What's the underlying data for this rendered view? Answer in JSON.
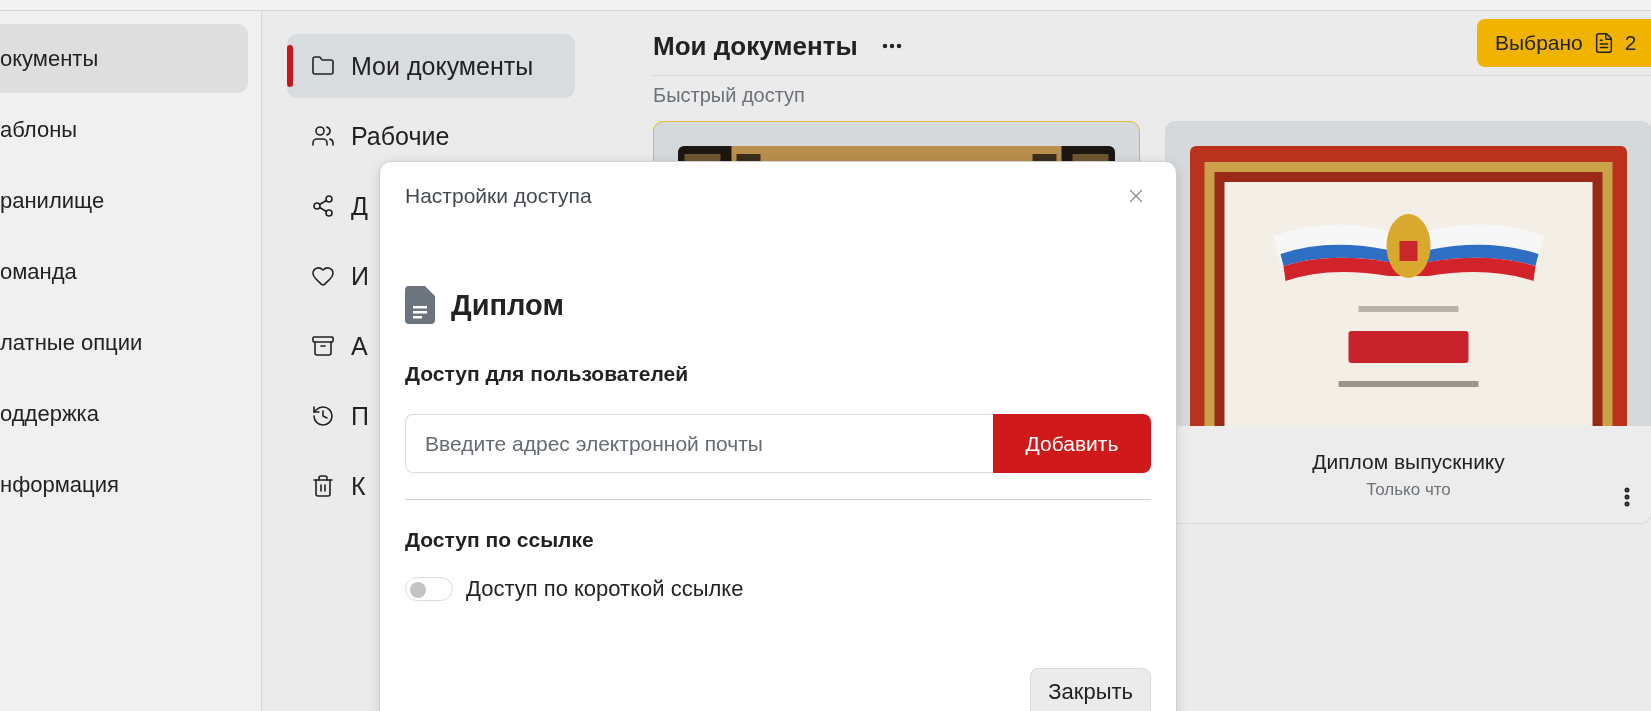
{
  "sidebar": {
    "items": [
      {
        "label": "окументы",
        "selected": true
      },
      {
        "label": "аблоны",
        "selected": false
      },
      {
        "label": "ранилище",
        "selected": false
      },
      {
        "label": "оманда",
        "selected": false
      },
      {
        "label": "латные опции",
        "selected": false
      },
      {
        "label": "оддержка",
        "selected": false
      },
      {
        "label": "нформация",
        "selected": false
      }
    ]
  },
  "folders": {
    "items": [
      {
        "label": "Мои документы",
        "kind": "folder",
        "selected": true
      },
      {
        "label": "Рабочие",
        "kind": "users",
        "selected": false
      },
      {
        "label": "Д",
        "kind": "share",
        "selected": false
      },
      {
        "label": "И",
        "kind": "heart",
        "selected": false
      },
      {
        "label": "А",
        "kind": "archive",
        "selected": false
      },
      {
        "label": "П",
        "kind": "history",
        "selected": false
      },
      {
        "label": "К",
        "kind": "trash",
        "selected": false
      }
    ]
  },
  "main": {
    "title": "Мои документы",
    "selection": {
      "label": "Выбрано",
      "count": "2"
    },
    "section": "Быстрый доступ",
    "cards": [
      {
        "selected": true,
        "kind": "picture"
      },
      {
        "selected": false,
        "kind": "picture",
        "title": "Диплом выпускнику",
        "subtitle": "Только что"
      }
    ]
  },
  "dialog": {
    "title": "Настройки доступа",
    "document": "Диплом",
    "users_heading": "Доступ для пользователей",
    "email": {
      "placeholder": "Введите адрес электронной почты"
    },
    "add_button": "Добавить",
    "link_heading": "Доступ по ссылке",
    "link_toggle": {
      "label": "Доступ по короткой ссылке",
      "on": false
    },
    "close_button": "Закрыть"
  }
}
